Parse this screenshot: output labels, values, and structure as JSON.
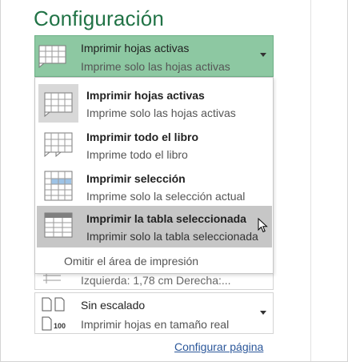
{
  "page": {
    "title": "Configuración"
  },
  "print_what": {
    "selected": {
      "title": "Imprimir hojas activas",
      "subtitle": "Imprime solo las hojas activas",
      "icon": "sheet-grid-icon"
    },
    "options": [
      {
        "title": "Imprimir hojas activas",
        "subtitle": "Imprime solo las hojas activas",
        "icon": "sheet-grid-icon"
      },
      {
        "title": "Imprimir todo el libro",
        "subtitle": "Imprime todo el libro",
        "icon": "workbook-icon"
      },
      {
        "title": "Imprimir selección",
        "subtitle": "Imprime solo la selección actual",
        "icon": "selection-icon"
      },
      {
        "title": "Imprimir la tabla seleccionada",
        "subtitle": "Imprimir solo la tabla seleccionada",
        "icon": "table-icon",
        "hovered": true
      }
    ],
    "ignore_print_area": "Omitir el área de impresión"
  },
  "margins": {
    "text": "Izquierda:  1,78 cm    Derecha:..."
  },
  "scaling": {
    "title": "Sin escalado",
    "subtitle": "Imprimir hojas en tamaño real",
    "icon_label": "100"
  },
  "footer": {
    "page_setup_link": "Configurar página"
  },
  "colors": {
    "accent": "#217346",
    "selected_bg": "#8dc8a2",
    "hover_bg": "#c6c6c6",
    "link": "#2b579a"
  }
}
